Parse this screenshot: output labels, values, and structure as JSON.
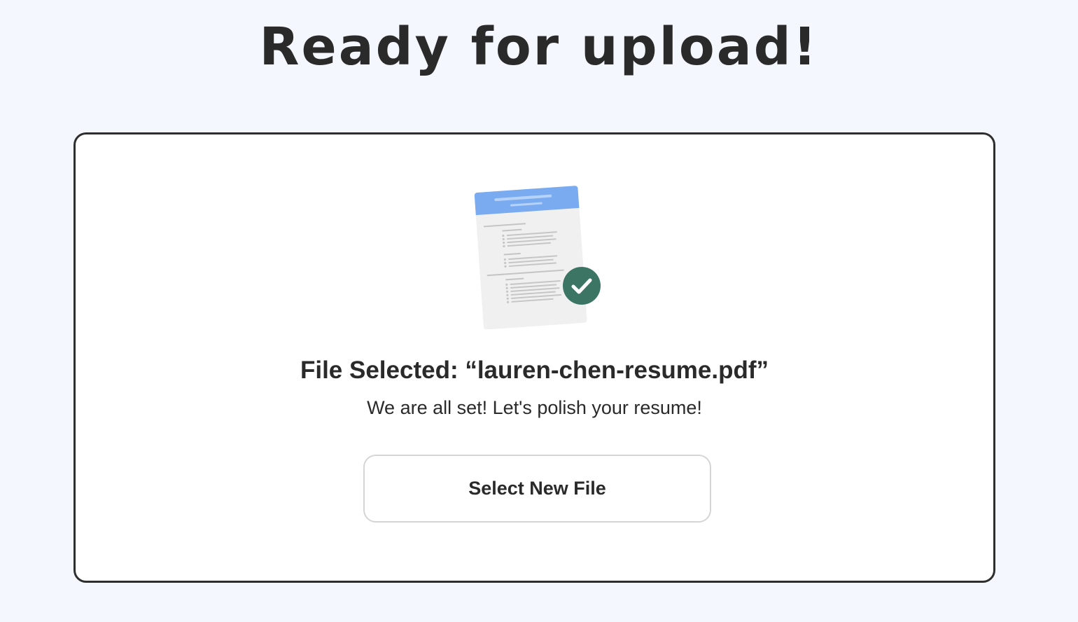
{
  "page": {
    "title": "Ready for upload!"
  },
  "upload_card": {
    "file_title": "File Selected: “lauren-chen-resume.pdf”",
    "subtitle": "We are all set! Let's polish your resume!",
    "select_button_label": "Select New File"
  },
  "icons": {
    "illustration": "resume-document-icon",
    "status": "check-circle-icon"
  },
  "colors": {
    "background": "#f4f7fe",
    "card_border": "#2e2e2e",
    "document_header": "#7aabf0",
    "document_page": "#f0f0f0",
    "check_badge": "#3d7565",
    "text": "#2a2a2a"
  }
}
